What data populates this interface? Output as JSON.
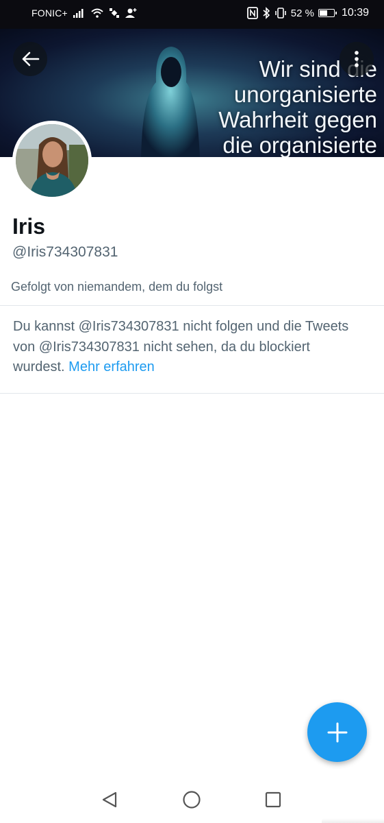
{
  "status_bar": {
    "carrier": "FONIC+",
    "battery_percent": "52 %",
    "time": "10:39",
    "icons": [
      "signal-icon",
      "wifi-icon",
      "satellite-icon",
      "contact-add-icon",
      "nfc-icon",
      "bluetooth-icon",
      "vibrate-icon",
      "battery-icon"
    ]
  },
  "header": {
    "banner_text_lines": [
      "Wir sind die",
      "unorganisierte",
      "Wahrheit gegen",
      "die organisierte"
    ],
    "back_icon": "arrow-left-icon",
    "more_icon": "more-vertical-icon"
  },
  "profile": {
    "name": "Iris",
    "handle": "@Iris734307831",
    "followed_by": "Gefolgt von niemandem, dem du folgst"
  },
  "blocked_notice": {
    "text": "Du kannst @Iris734307831 nicht folgen und die Tweets von @Iris734307831 nicht sehen, da du blockiert wurdest.",
    "link": "Mehr erfahren"
  },
  "fab": {
    "icon": "plus-icon"
  },
  "nav_bar": {
    "icons": [
      "nav-back-icon",
      "nav-home-icon",
      "nav-recents-icon"
    ]
  },
  "colors": {
    "accent": "#1d9bf0",
    "text_primary": "#0f1419",
    "text_secondary": "#536471",
    "status_bar": "#0b0b10"
  }
}
